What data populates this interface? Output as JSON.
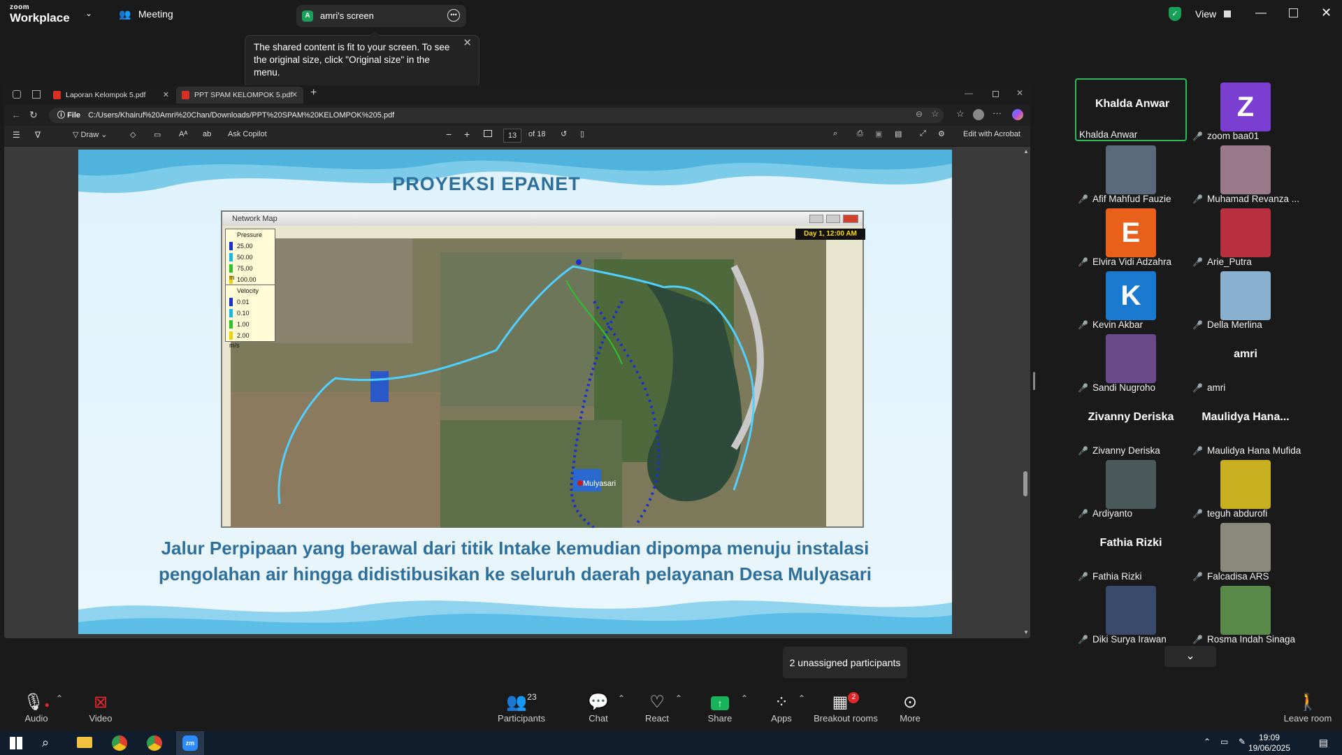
{
  "zoom": {
    "logo_small": "zoom",
    "logo_big": "Workplace",
    "meeting_label": "Meeting",
    "share_pill_initial": "A",
    "share_pill_label": "amri's screen",
    "view_label": "View",
    "tooltip_text": "The shared content is fit to your screen. To see the original size, click \"Original size\" in the menu."
  },
  "browser": {
    "tabs": [
      {
        "label": "Laporan Kelompok 5.pdf"
      },
      {
        "label": "PPT SPAM KELOMPOK 5.pdf"
      }
    ],
    "address_prefix": "File",
    "address": "C:/Users/Khairuf%20Amri%20Chan/Downloads/PPT%20SPAM%20KELOMPOK%205.pdf",
    "toolbar": {
      "draw_label": "Draw",
      "copilot_label": "Ask Copilot",
      "page_current": "13",
      "page_total": "of 18",
      "edit_label": "Edit with Acrobat"
    }
  },
  "slide": {
    "title": "PROYEKSI EPANET",
    "network_map": {
      "window_title": "Network Map",
      "day_label": "Day 1, 12:00 AM",
      "pressure_legend": {
        "title": "Pressure",
        "items": [
          "25.00",
          "50.00",
          "75.00",
          "100.00"
        ],
        "unit": "m"
      },
      "velocity_legend": {
        "title": "Velocity",
        "items": [
          "0.01",
          "0.10",
          "1.00",
          "2.00"
        ],
        "unit": "m/s"
      },
      "legend_colors": [
        "#1a2fd0",
        "#1ab8e0",
        "#2ec02e",
        "#e8d21a",
        "#d01a1a"
      ],
      "place_label": "Mulyasari"
    },
    "caption_line1": "Jalur Perpipaan yang berawal dari titik Intake kemudian dipompa menuju instalasi",
    "caption_line2": "pengolahan air hingga didistibusikan ke seluruh daerah pelayanan Desa Mulyasari"
  },
  "gallery": [
    {
      "name": "Khalda Anwar",
      "big": "Khalda Anwar",
      "muted": false,
      "active": true
    },
    {
      "name": "zoom baa01",
      "letter": "Z",
      "color": "#7a3fd0",
      "muted": true
    },
    {
      "name": "Afif Mahfud Fauzie",
      "photo": "#5a6a7a",
      "muted": true
    },
    {
      "name": "Muhamad Revanza ...",
      "photo": "#9a7a8a",
      "muted": true
    },
    {
      "name": "Elvira Vidi Adzahra",
      "letter": "E",
      "color": "#e8601a",
      "muted": true
    },
    {
      "name": "Arie_Putra",
      "photo": "#b83040",
      "muted": true
    },
    {
      "name": "Kevin Akbar",
      "letter": "K",
      "color": "#1a7ad0",
      "muted": true
    },
    {
      "name": "Della Merlina",
      "photo": "#8ab0d0",
      "muted": true
    },
    {
      "name": "Sandi Nugroho",
      "photo": "#6a4a8a",
      "muted": true
    },
    {
      "name": "amri",
      "big": "amri",
      "muted": true
    },
    {
      "name": "Zivanny Deriska",
      "big": "Zivanny Deriska",
      "muted": true
    },
    {
      "name": "Maulidya Hana Mufida",
      "big": "Maulidya  Hana...",
      "muted": true
    },
    {
      "name": "Ardiyanto",
      "photo": "#4a5a5a",
      "muted": true
    },
    {
      "name": "teguh abdurofi",
      "photo": "#c8b020",
      "muted": true
    },
    {
      "name": "Fathia Rizki",
      "big": "Fathia Rizki",
      "muted": true
    },
    {
      "name": "Falcadisa ARS",
      "photo": "#8a8a7a",
      "muted": true
    },
    {
      "name": "Diki Surya Irawan",
      "photo": "#3a4a6a",
      "muted": true
    },
    {
      "name": "Rosma Indah Sinaga",
      "photo": "#5a8a4a",
      "muted": true
    }
  ],
  "controls": {
    "audio": "Audio",
    "video": "Video",
    "participants": "Participants",
    "participants_count": "23",
    "chat": "Chat",
    "react": "React",
    "share": "Share",
    "apps": "Apps",
    "breakout": "Breakout rooms",
    "breakout_badge": "2",
    "more": "More",
    "leave": "Leave room",
    "unassigned": "2 unassigned participants"
  },
  "taskbar": {
    "time": "19:09",
    "date": "19/06/2025"
  }
}
